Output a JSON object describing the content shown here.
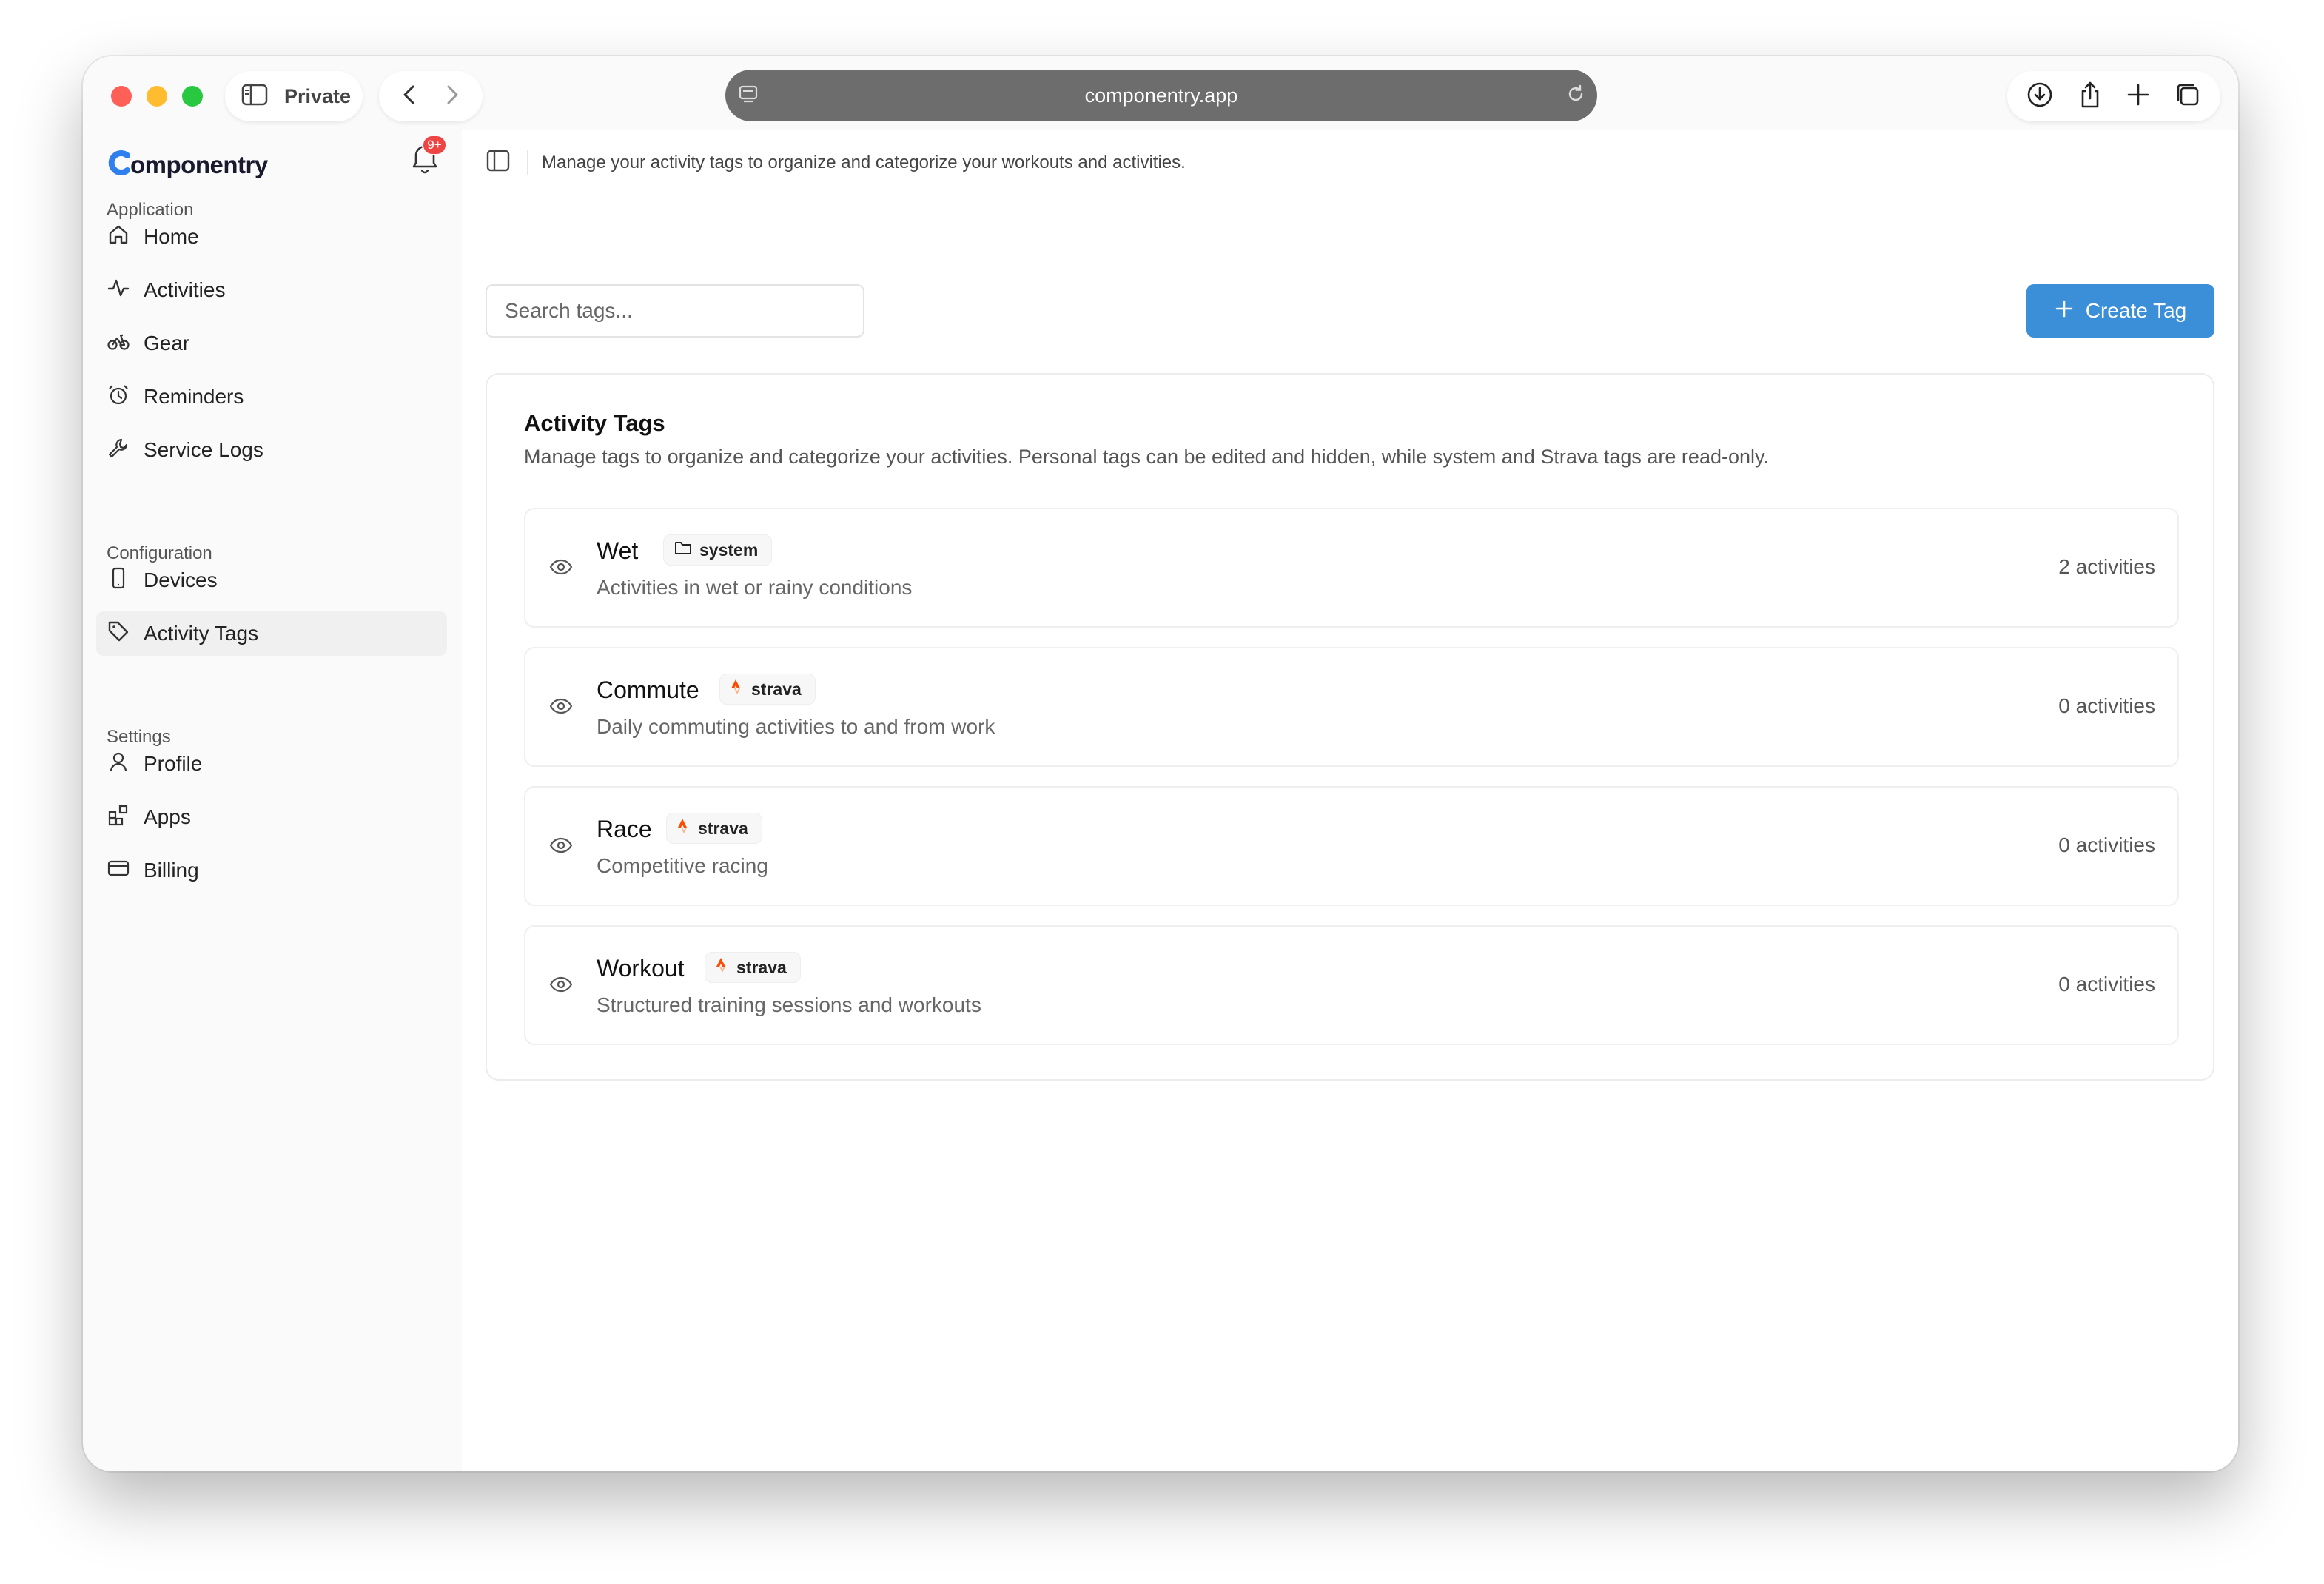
{
  "browser": {
    "private_label": "Private",
    "url": "componentry.app"
  },
  "sidebar": {
    "brand": "omponentry",
    "notification_badge": "9+",
    "sections": [
      {
        "label": "Application"
      },
      {
        "label": "Configuration"
      },
      {
        "label": "Settings"
      }
    ],
    "items": [
      {
        "label": "Home",
        "icon": "home-icon"
      },
      {
        "label": "Activities",
        "icon": "activity-icon"
      },
      {
        "label": "Gear",
        "icon": "bike-icon"
      },
      {
        "label": "Reminders",
        "icon": "alarm-clock-icon"
      },
      {
        "label": "Service Logs",
        "icon": "wrench-icon"
      },
      {
        "label": "Devices",
        "icon": "smartphone-icon"
      },
      {
        "label": "Activity Tags",
        "icon": "tag-icon",
        "active": true
      },
      {
        "label": "Profile",
        "icon": "user-icon"
      },
      {
        "label": "Apps",
        "icon": "apps-icon"
      },
      {
        "label": "Billing",
        "icon": "credit-card-icon"
      }
    ]
  },
  "header": {
    "description": "Manage your activity tags to organize and categorize your workouts and activities."
  },
  "toolbar": {
    "search_placeholder": "Search tags...",
    "create_label": "Create Tag"
  },
  "card": {
    "title": "Activity Tags",
    "subtitle": "Manage tags to organize and categorize your activities. Personal tags can be edited and hidden, while system and Strava tags are read-only.",
    "tags": [
      {
        "name": "Wet",
        "badge": "system",
        "badge_icon": "folder-icon",
        "description": "Activities in wet or rainy conditions",
        "count": "2 activities"
      },
      {
        "name": "Commute",
        "badge": "strava",
        "badge_icon": "strava-icon",
        "description": "Daily commuting activities to and from work",
        "count": "0 activities"
      },
      {
        "name": "Race",
        "badge": "strava",
        "badge_icon": "strava-icon",
        "description": "Competitive racing",
        "count": "0 activities"
      },
      {
        "name": "Workout",
        "badge": "strava",
        "badge_icon": "strava-icon",
        "description": "Structured training sessions and workouts",
        "count": "0 activities"
      }
    ]
  },
  "colors": {
    "accent": "#3b8fd9",
    "strava": "#fc4c02",
    "badge": "#ef4444"
  }
}
